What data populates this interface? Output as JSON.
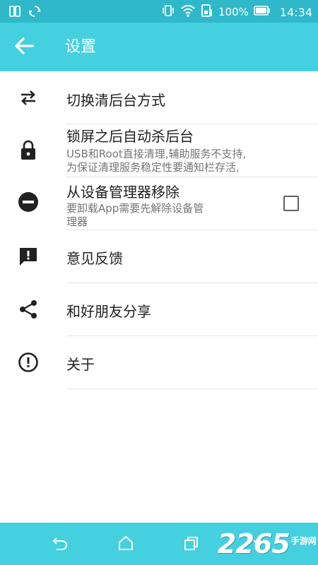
{
  "status_bar": {
    "left_icons": [
      "sim-card-icon",
      "sync-icon"
    ],
    "right_icons": [
      "vibrate-icon",
      "wifi-icon",
      "sim-signal-icon",
      "battery-icon"
    ],
    "battery_percent": "100%",
    "time": "14:34"
  },
  "app_bar": {
    "title": "设置",
    "back_icon": "arrow-back-icon"
  },
  "settings": [
    {
      "icon": "swap-arrows-icon",
      "title": "切换清后台方式"
    },
    {
      "icon": "lock-icon",
      "title": "锁屏之后自动杀后台",
      "subtitle": [
        "USB和Root直接清理,辅助服务不支持,",
        "为保证清理服务稳定性要通知栏存活,"
      ],
      "checkbox_checked": false
    },
    {
      "icon": "remove-circle-icon",
      "title": "从设备管理器移除",
      "subtitle": [
        "要卸载App需要先解除设备管",
        "理器"
      ]
    },
    {
      "icon": "feedback-icon",
      "title": "意见反馈"
    },
    {
      "icon": "share-icon",
      "title": "和好朋友分享"
    },
    {
      "icon": "info-icon",
      "title": "关于"
    }
  ],
  "nav_bar": {
    "buttons": [
      "back-nav-icon",
      "home-icon",
      "recents-icon",
      "collapse-icon"
    ]
  },
  "watermark": {
    "number": "2265",
    "text": "手游网"
  },
  "colors": {
    "status_bar": "#2fb8c9",
    "app_bar": "#44d0df",
    "nav_bar": "#44d0df",
    "icon": "#212121"
  }
}
